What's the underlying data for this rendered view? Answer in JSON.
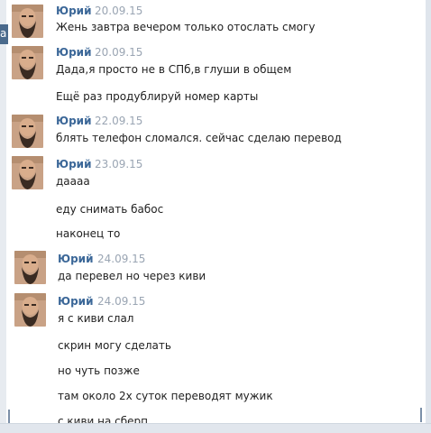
{
  "left_tab_label": "а",
  "messages": [
    {
      "sender": "Юрий",
      "date": "20.09.15",
      "lines": [
        "Жень завтра вечером только отослать смогу"
      ]
    },
    {
      "sender": "Юрий",
      "date": "20.09.15",
      "lines": [
        "Дада,я просто не в СПб,в глуши в общем",
        "Ещё раз продублируй номер карты"
      ]
    },
    {
      "sender": "Юрий",
      "date": "22.09.15",
      "lines": [
        "блять телефон сломался. сейчас сделаю перевод"
      ]
    },
    {
      "sender": "Юрий",
      "date": "23.09.15",
      "lines": [
        "даааа",
        "еду снимать бабос",
        "наконец то"
      ]
    },
    {
      "sender": "Юрий",
      "date": "24.09.15",
      "lines": [
        "да перевел но через киви"
      ]
    },
    {
      "sender": "Юрий",
      "date": "24.09.15",
      "lines": [
        "я с киви слал",
        "скрин могу сделать",
        "но чуть позже",
        "там около 2х суток переводят мужик",
        "с киви на сберп"
      ]
    }
  ],
  "colors": {
    "sender": "#3b6798",
    "date": "#9aa5b3",
    "text": "#222222",
    "accent": "#4a6a8c"
  }
}
